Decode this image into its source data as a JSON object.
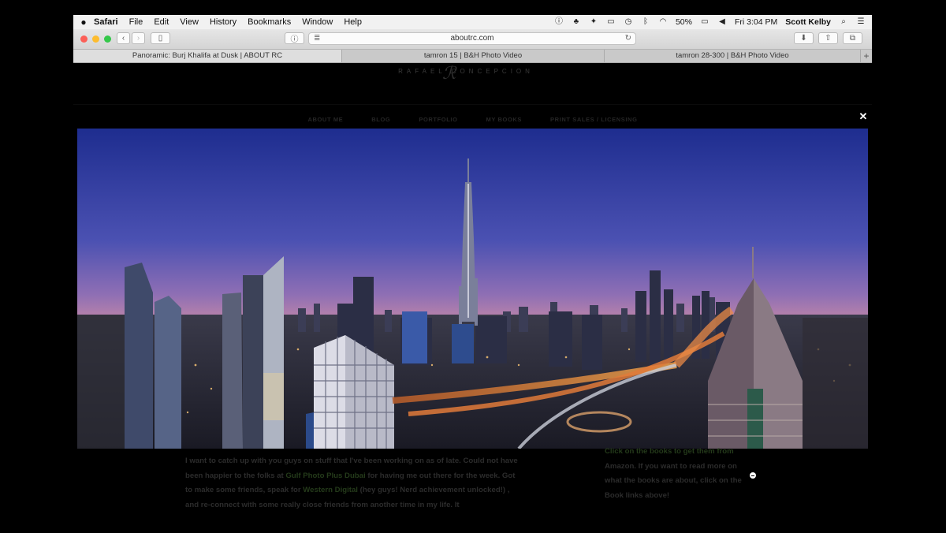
{
  "menubar": {
    "app_name": "Safari",
    "items": [
      "File",
      "Edit",
      "View",
      "History",
      "Bookmarks",
      "Window",
      "Help"
    ],
    "battery": "50%",
    "clock": "Fri 3:04 PM",
    "user": "Scott Kelby"
  },
  "toolbar": {
    "url": "aboutrc.com"
  },
  "tabs": [
    {
      "label": "Panoramic: Burj Khalifa at Dusk | ABOUT RC",
      "active": true
    },
    {
      "label": "tamron 15 | B&H Photo Video",
      "active": false
    },
    {
      "label": "tamron 28-300 | B&H Photo Video",
      "active": false
    }
  ],
  "site": {
    "logo_text": "RAFAEL CONCEPCION",
    "nav": [
      "ABOUT ME",
      "BLOG",
      "PORTFOLIO",
      "MY BOOKS",
      "PRINT SALES / LICENSING"
    ]
  },
  "lightbox": {
    "close_symbol": "✕"
  },
  "post": {
    "p1": "I want to catch up with you guys on stuff that I've been working on as of late. Could not have been happier to the folks at ",
    "link1": "Gulf Photo Plus Dubai",
    "p2": " for having me out there for the week. Got to make some friends, speak for ",
    "link2": "Western Digital",
    "p3": " (hey guys! Nerd achievement unlocked!) , and re-connect with some really close friends from another time in my life. It"
  },
  "sidebar": {
    "link_text": "Click on the books to get them from",
    "text": " Amazon. If you want to read more on what the books are about, click on the Book links above!"
  },
  "colors": {
    "sky_top": "#1e2d8f",
    "sky_horizon": "#e2a08f",
    "menubar_bg": "#f1f1f1",
    "page_bg": "#000000"
  }
}
